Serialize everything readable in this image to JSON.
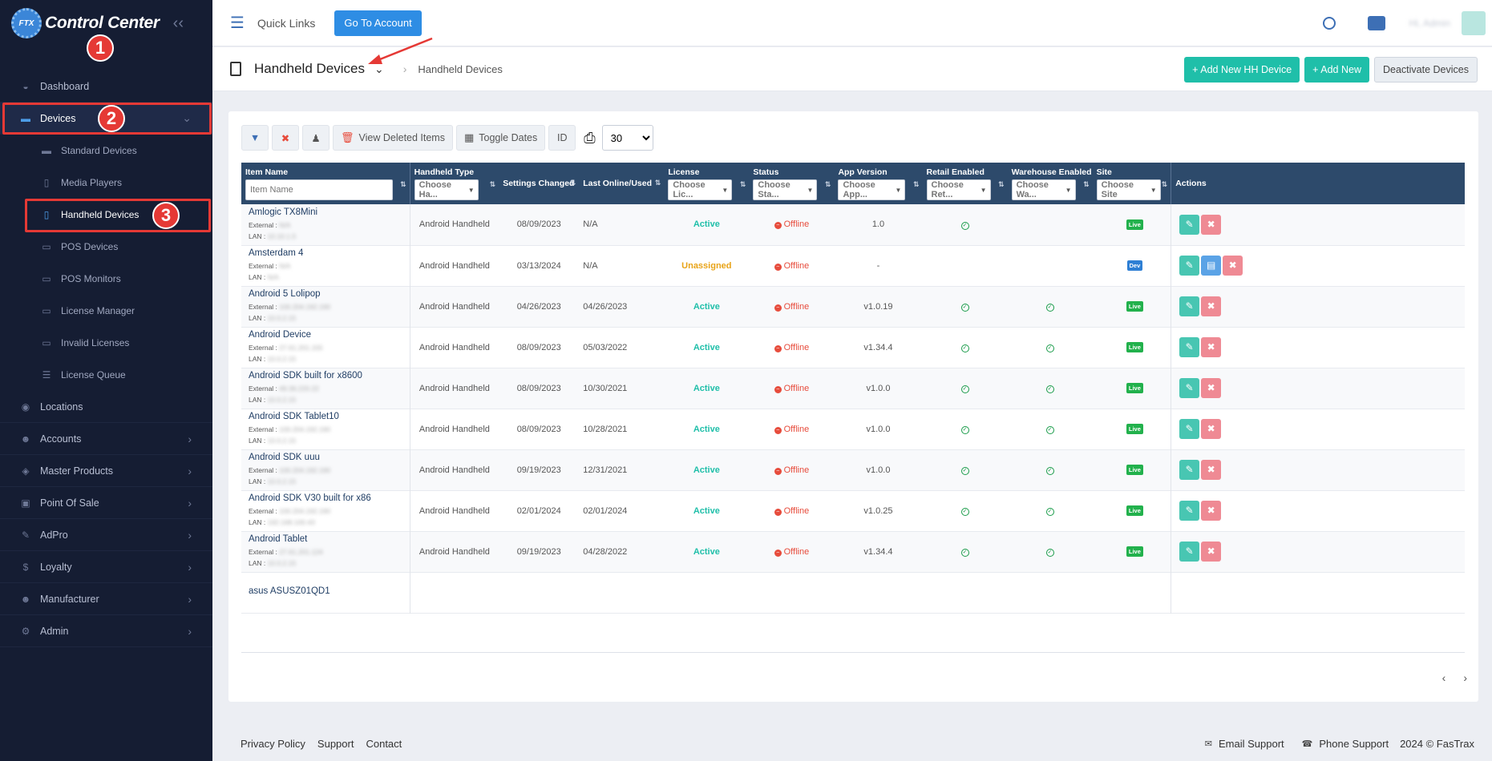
{
  "app": {
    "title": "Control Center",
    "logo_badge": "FTX"
  },
  "annotations": [
    "1",
    "2",
    "3"
  ],
  "sidebar": {
    "items": [
      {
        "label": "Dashboard",
        "icon": "dashboard-icon"
      },
      {
        "label": "Devices",
        "icon": "devices-icon",
        "expanded": true
      },
      {
        "label": "Locations",
        "icon": "location-pin-icon"
      },
      {
        "label": "Accounts",
        "icon": "users-icon"
      },
      {
        "label": "Master Products",
        "icon": "box-icon"
      },
      {
        "label": "Point Of Sale",
        "icon": "cart-icon"
      },
      {
        "label": "AdPro",
        "icon": "pen-icon"
      },
      {
        "label": "Loyalty",
        "icon": "dollar-icon"
      },
      {
        "label": "Manufacturer",
        "icon": "users-icon"
      },
      {
        "label": "Admin",
        "icon": "gear-icon"
      }
    ],
    "sub_items": [
      {
        "label": "Standard Devices"
      },
      {
        "label": "Media Players"
      },
      {
        "label": "Handheld Devices",
        "active": true
      },
      {
        "label": "POS Devices"
      },
      {
        "label": "POS Monitors"
      },
      {
        "label": "License Manager"
      },
      {
        "label": "Invalid Licenses"
      },
      {
        "label": "License Queue"
      }
    ]
  },
  "topbar": {
    "quick_links": "Quick Links",
    "go_to_account": "Go To Account",
    "user_name": "Hi, Admin"
  },
  "page_header": {
    "title": "Handheld Devices",
    "breadcrumb": "Handheld Devices",
    "add_hh": "Add New HH Device",
    "add_new": "Add New",
    "deactivate": "Deactivate Devices"
  },
  "toolbar": {
    "view_deleted": "View Deleted Items",
    "toggle_dates": "Toggle Dates",
    "id": "ID",
    "page_size": "30"
  },
  "table": {
    "headers": {
      "item_name": "Item Name",
      "handheld_type": "Handheld Type",
      "settings_changed": "Settings Changed",
      "last_online": "Last Online/Used",
      "license": "License",
      "status": "Status",
      "app_version": "App Version",
      "retail_enabled": "Retail Enabled",
      "warehouse_enabled": "Warehouse Enabled",
      "site": "Site",
      "actions": "Actions"
    },
    "filters": {
      "item_name": "Item Name",
      "handheld_type": "Choose Ha...",
      "license": "Choose Lic...",
      "status": "Choose Sta...",
      "app_version": "Choose App...",
      "retail_enabled": "Choose Ret...",
      "warehouse_enabled": "Choose Wa...",
      "site": "Choose Site"
    },
    "sub_labels": {
      "external": "External :",
      "lan": "LAN :"
    },
    "rows": [
      {
        "name": "Amlogic TX8Mini",
        "external": "N/A",
        "lan": "10.10.1.5",
        "type": "Android Handheld",
        "settings": "08/09/2023",
        "last": "N/A",
        "license": "Active",
        "status": "Offline",
        "version": "1.0",
        "retail": true,
        "warehouse": false,
        "site": "Live"
      },
      {
        "name": "Amsterdam 4",
        "external": "N/A",
        "lan": "N/A",
        "type": "Android Handheld",
        "settings": "03/13/2024",
        "last": "N/A",
        "license": "Unassigned",
        "status": "Offline",
        "version": "-",
        "retail": false,
        "warehouse": false,
        "site": "Dev"
      },
      {
        "name": "Android 5 Lolipop",
        "external": "100.204.192.190",
        "lan": "10.0.2.15",
        "type": "Android Handheld",
        "settings": "04/26/2023",
        "last": "04/26/2023",
        "license": "Active",
        "status": "Offline",
        "version": "v1.0.19",
        "retail": true,
        "warehouse": true,
        "site": "Live"
      },
      {
        "name": "Android Device",
        "external": "27.61.201.155",
        "lan": "10.0.2.15",
        "type": "Android Handheld",
        "settings": "08/09/2023",
        "last": "05/03/2022",
        "license": "Active",
        "status": "Offline",
        "version": "v1.34.4",
        "retail": true,
        "warehouse": true,
        "site": "Live"
      },
      {
        "name": "Android SDK built for x8600",
        "external": "49.36.220.22",
        "lan": "10.0.2.15",
        "type": "Android Handheld",
        "settings": "08/09/2023",
        "last": "10/30/2021",
        "license": "Active",
        "status": "Offline",
        "version": "v1.0.0",
        "retail": true,
        "warehouse": true,
        "site": "Live"
      },
      {
        "name": "Android SDK Tablet10",
        "external": "100.204.192.190",
        "lan": "10.0.2.15",
        "type": "Android Handheld",
        "settings": "08/09/2023",
        "last": "10/28/2021",
        "license": "Active",
        "status": "Offline",
        "version": "v1.0.0",
        "retail": true,
        "warehouse": true,
        "site": "Live"
      },
      {
        "name": "Android SDK uuu",
        "external": "100.204.192.190",
        "lan": "10.0.2.15",
        "type": "Android Handheld",
        "settings": "09/19/2023",
        "last": "12/31/2021",
        "license": "Active",
        "status": "Offline",
        "version": "v1.0.0",
        "retail": true,
        "warehouse": true,
        "site": "Live"
      },
      {
        "name": "Android SDK V30 built for x86",
        "external": "100.204.192.190",
        "lan": "192.168.100.43",
        "type": "Android Handheld",
        "settings": "02/01/2024",
        "last": "02/01/2024",
        "license": "Active",
        "status": "Offline",
        "version": "v1.0.25",
        "retail": true,
        "warehouse": true,
        "site": "Live"
      },
      {
        "name": "Android Tablet",
        "external": "27.61.201.124",
        "lan": "10.0.2.15",
        "type": "Android Handheld",
        "settings": "09/19/2023",
        "last": "04/28/2022",
        "license": "Active",
        "status": "Offline",
        "version": "v1.34.4",
        "retail": true,
        "warehouse": true,
        "site": "Live"
      },
      {
        "name": "asus ASUSZ01QD1",
        "external": "",
        "lan": "",
        "type": "",
        "settings": "",
        "last": "",
        "license": "",
        "status": "",
        "version": "",
        "retail": false,
        "warehouse": false,
        "site": ""
      }
    ]
  },
  "footer": {
    "privacy": "Privacy Policy",
    "support": "Support",
    "contact": "Contact",
    "email_support": "Email Support",
    "phone_support": "Phone Support",
    "copyright": "2024 © FasTrax"
  },
  "colors": {
    "sidebar_bg": "#151d33",
    "accent_teal": "#1fbfa9",
    "accent_blue": "#2e8de4",
    "table_header": "#2d4a6b",
    "annotation_red": "#e53935"
  }
}
